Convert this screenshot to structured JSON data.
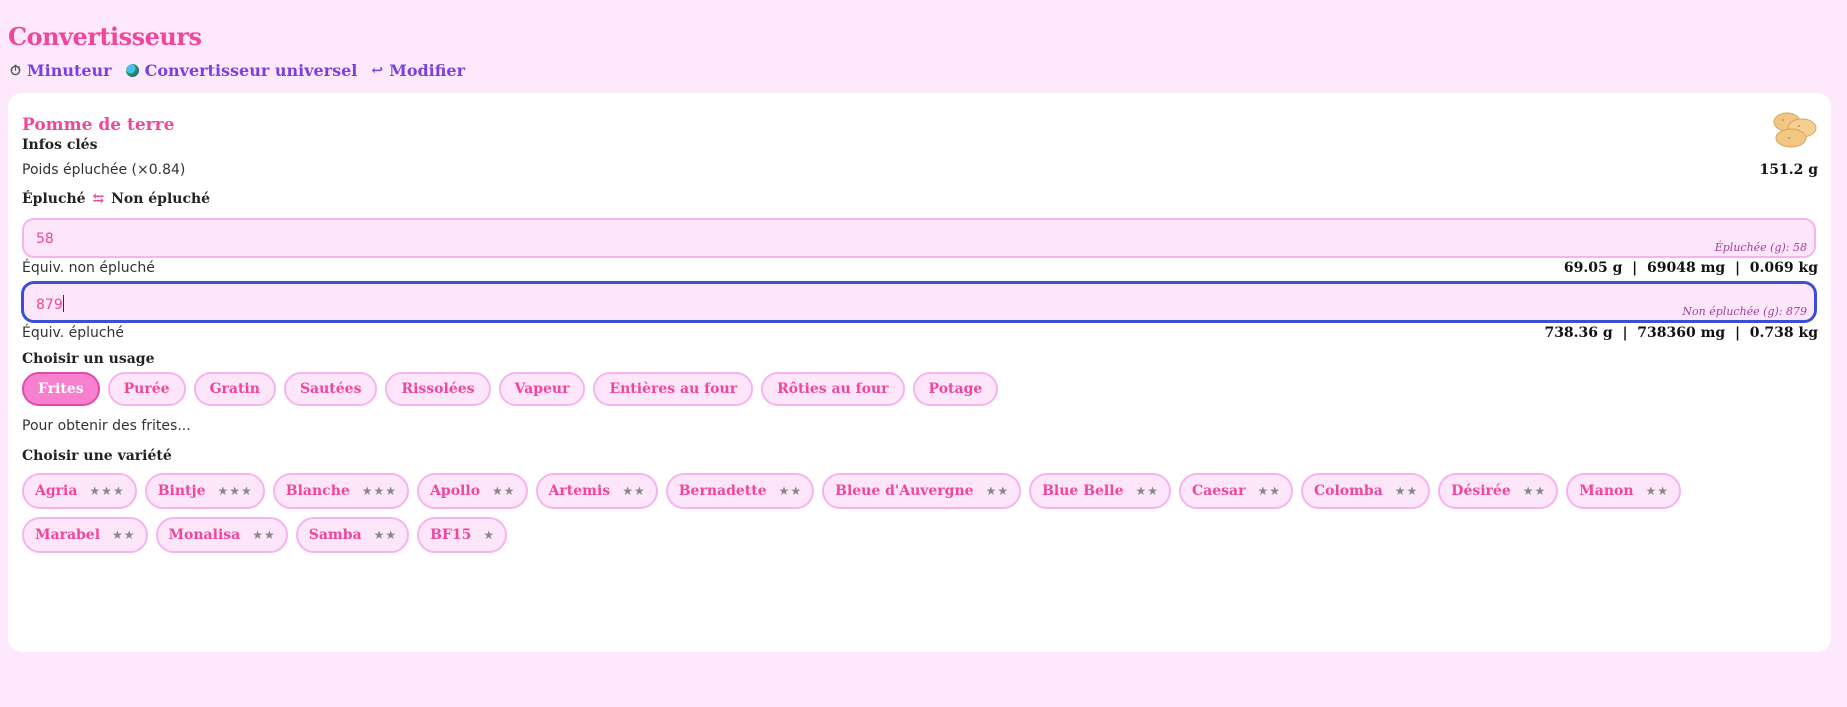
{
  "app": {
    "title": "Convertisseurs"
  },
  "nav": [
    {
      "icon": "stopwatch-icon",
      "label": "Minuteur"
    },
    {
      "icon": "globe-icon",
      "label": "Convertisseur universel"
    },
    {
      "icon": "return-arrow-icon",
      "label": "Modifier"
    }
  ],
  "card": {
    "title": "Pomme de terre",
    "key_info": {
      "heading": "Infos clés",
      "label": "Poids épluchée (×0.84)",
      "value": "151.2 g"
    },
    "conversion": {
      "heading_left": "Épluché",
      "heading_right": "Non épluché",
      "input1": {
        "value": "58",
        "hint": "Épluchée (g): 58",
        "equiv_label": "Équiv. non épluché",
        "equiv_value": "69.05 g  |  69048 mg  |  0.069 kg"
      },
      "input2": {
        "value": "879",
        "hint": "Non épluchée (g): 879",
        "equiv_label": "Équiv. épluché",
        "equiv_value": "738.36 g  |  738360 mg  |  0.738 kg"
      }
    },
    "usage": {
      "heading": "Choisir un usage",
      "selected": "Frites",
      "options": [
        "Frites",
        "Purée",
        "Gratin",
        "Sautées",
        "Rissolées",
        "Vapeur",
        "Entières au four",
        "Rôties au four",
        "Potage"
      ],
      "description": "Pour obtenir des frites..."
    },
    "variety": {
      "heading": "Choisir une variété",
      "items": [
        {
          "name": "Agria",
          "stars": "★★★"
        },
        {
          "name": "Bintje",
          "stars": "★★★"
        },
        {
          "name": "Blanche",
          "stars": "★★★"
        },
        {
          "name": "Apollo",
          "stars": "★★"
        },
        {
          "name": "Artemis",
          "stars": "★★"
        },
        {
          "name": "Bernadette",
          "stars": "★★"
        },
        {
          "name": "Bleue d'Auvergne",
          "stars": "★★"
        },
        {
          "name": "Blue Belle",
          "stars": "★★"
        },
        {
          "name": "Caesar",
          "stars": "★★"
        },
        {
          "name": "Colomba",
          "stars": "★★"
        },
        {
          "name": "Désirée",
          "stars": "★★"
        },
        {
          "name": "Manon",
          "stars": "★★"
        },
        {
          "name": "Marabel",
          "stars": "★★"
        },
        {
          "name": "Monalisa",
          "stars": "★★"
        },
        {
          "name": "Samba",
          "stars": "★★"
        },
        {
          "name": "BF15",
          "stars": "★"
        }
      ]
    }
  },
  "colors": {
    "accent": "#f0469c",
    "link": "#7c3fe0",
    "background": "#fde9fb",
    "focus": "#3a4fd6"
  }
}
